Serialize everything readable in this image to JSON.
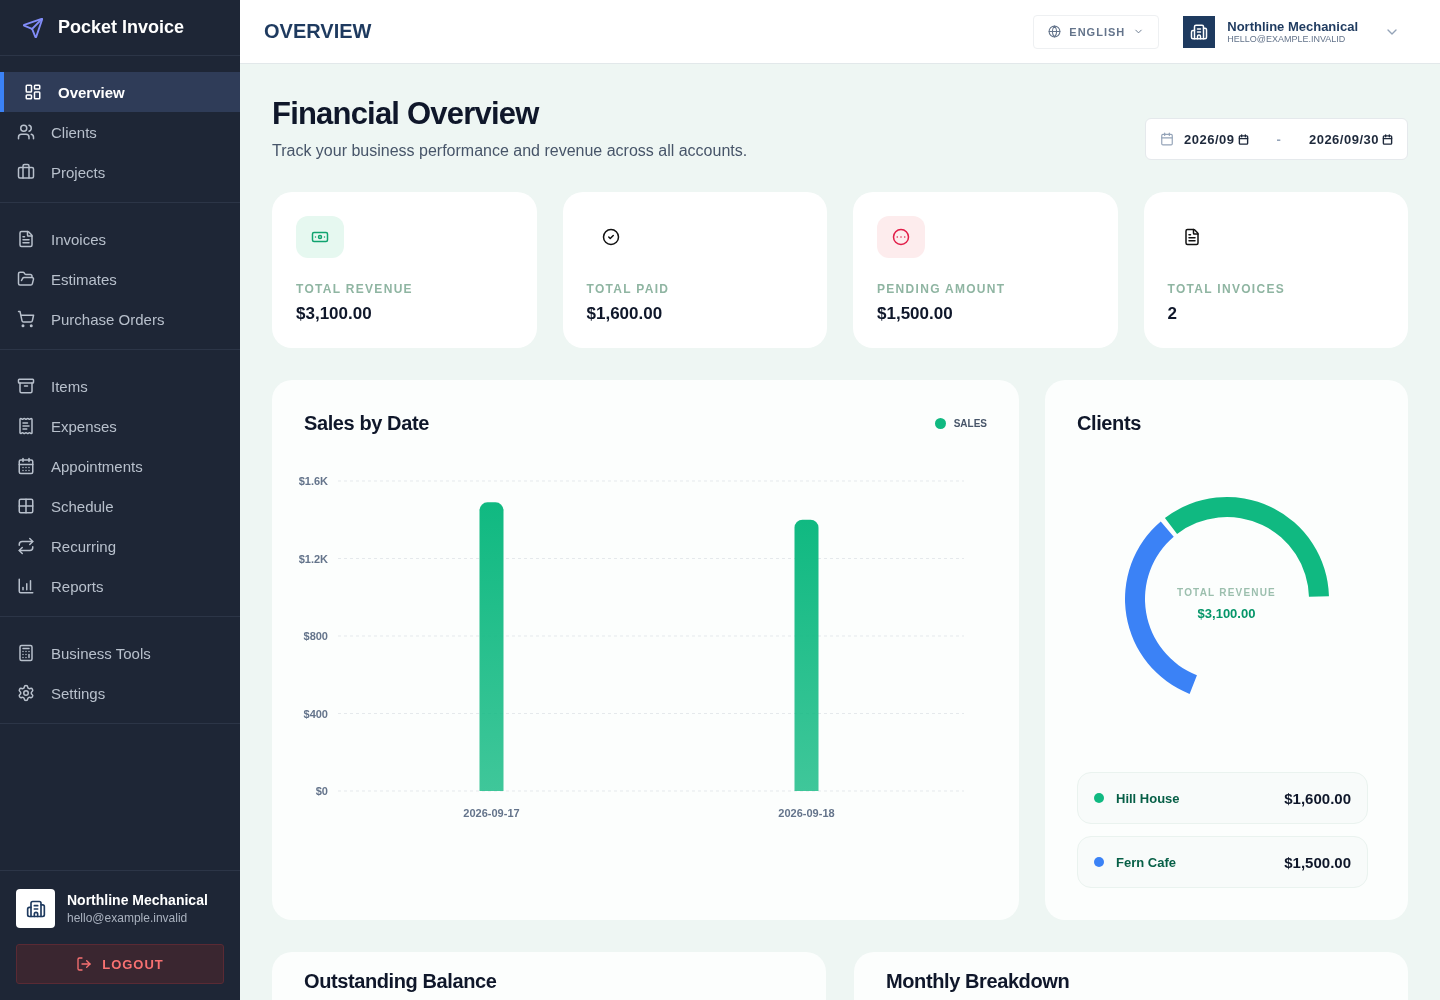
{
  "sidebar": {
    "brand": "Pocket Invoice",
    "groups": [
      [
        {
          "label": "Overview",
          "selected": true
        },
        {
          "label": "Clients",
          "selected": false
        },
        {
          "label": "Projects",
          "selected": false
        }
      ],
      [
        {
          "label": "Invoices",
          "selected": false
        },
        {
          "label": "Estimates",
          "selected": false
        },
        {
          "label": "Purchase Orders",
          "selected": false
        }
      ],
      [
        {
          "label": "Items",
          "selected": false
        },
        {
          "label": "Expenses",
          "selected": false
        },
        {
          "label": "Appointments",
          "selected": false
        },
        {
          "label": "Schedule",
          "selected": false
        },
        {
          "label": "Recurring",
          "selected": false
        },
        {
          "label": "Reports",
          "selected": false
        }
      ],
      [
        {
          "label": "Business Tools",
          "selected": false
        },
        {
          "label": "Settings",
          "selected": false
        }
      ]
    ],
    "account": {
      "name": "Northline Mechanical",
      "email": "hello@example.invalid"
    },
    "logout": "LOGOUT"
  },
  "header": {
    "title": "OVERVIEW",
    "language": "ENGLISH",
    "account": {
      "name": "Northline Mechanical",
      "email": "HELLO@EXAMPLE.INVALID"
    }
  },
  "page": {
    "title": "Financial Overview",
    "subtitle": "Track your business performance and revenue across all accounts.",
    "date_from": "2026/09",
    "date_to": "2026/09/30",
    "date_separator": "-"
  },
  "stats": [
    {
      "label": "TOTAL REVENUE",
      "value": "$3,100.00"
    },
    {
      "label": "TOTAL PAID",
      "value": "$1,600.00"
    },
    {
      "label": "PENDING AMOUNT",
      "value": "$1,500.00"
    },
    {
      "label": "TOTAL INVOICES",
      "value": "2"
    }
  ],
  "sales": {
    "title": "Sales by Date",
    "chart_data": {
      "type": "bar",
      "grid": true,
      "categories": [
        "2026-09-17",
        "2026-09-18"
      ],
      "series": [
        {
          "name": "SALES",
          "color": "#10b981",
          "values": [
            1490,
            1400
          ]
        }
      ],
      "ylim": [
        0,
        1600
      ],
      "yticks": [
        {
          "value": 0,
          "label": "$0"
        },
        {
          "value": 400,
          "label": "$400"
        },
        {
          "value": 800,
          "label": "$800"
        },
        {
          "value": 1200,
          "label": "$1.2K"
        },
        {
          "value": 1600,
          "label": "$1.6K"
        }
      ]
    }
  },
  "clients": {
    "title": "Clients",
    "center_label": "TOTAL REVENUE",
    "center_value": "$3,100.00",
    "chart_data": {
      "type": "donut",
      "values": [
        51.6,
        48.4
      ]
    },
    "items": [
      {
        "name": "Hill House",
        "amount": "$1,600.00",
        "color": "#10b981"
      },
      {
        "name": "Fern Cafe",
        "amount": "$1,500.00",
        "color": "#3b82f6"
      }
    ]
  },
  "bottom_cards": [
    {
      "title": "Outstanding Balance"
    },
    {
      "title": "Monthly Breakdown"
    }
  ]
}
